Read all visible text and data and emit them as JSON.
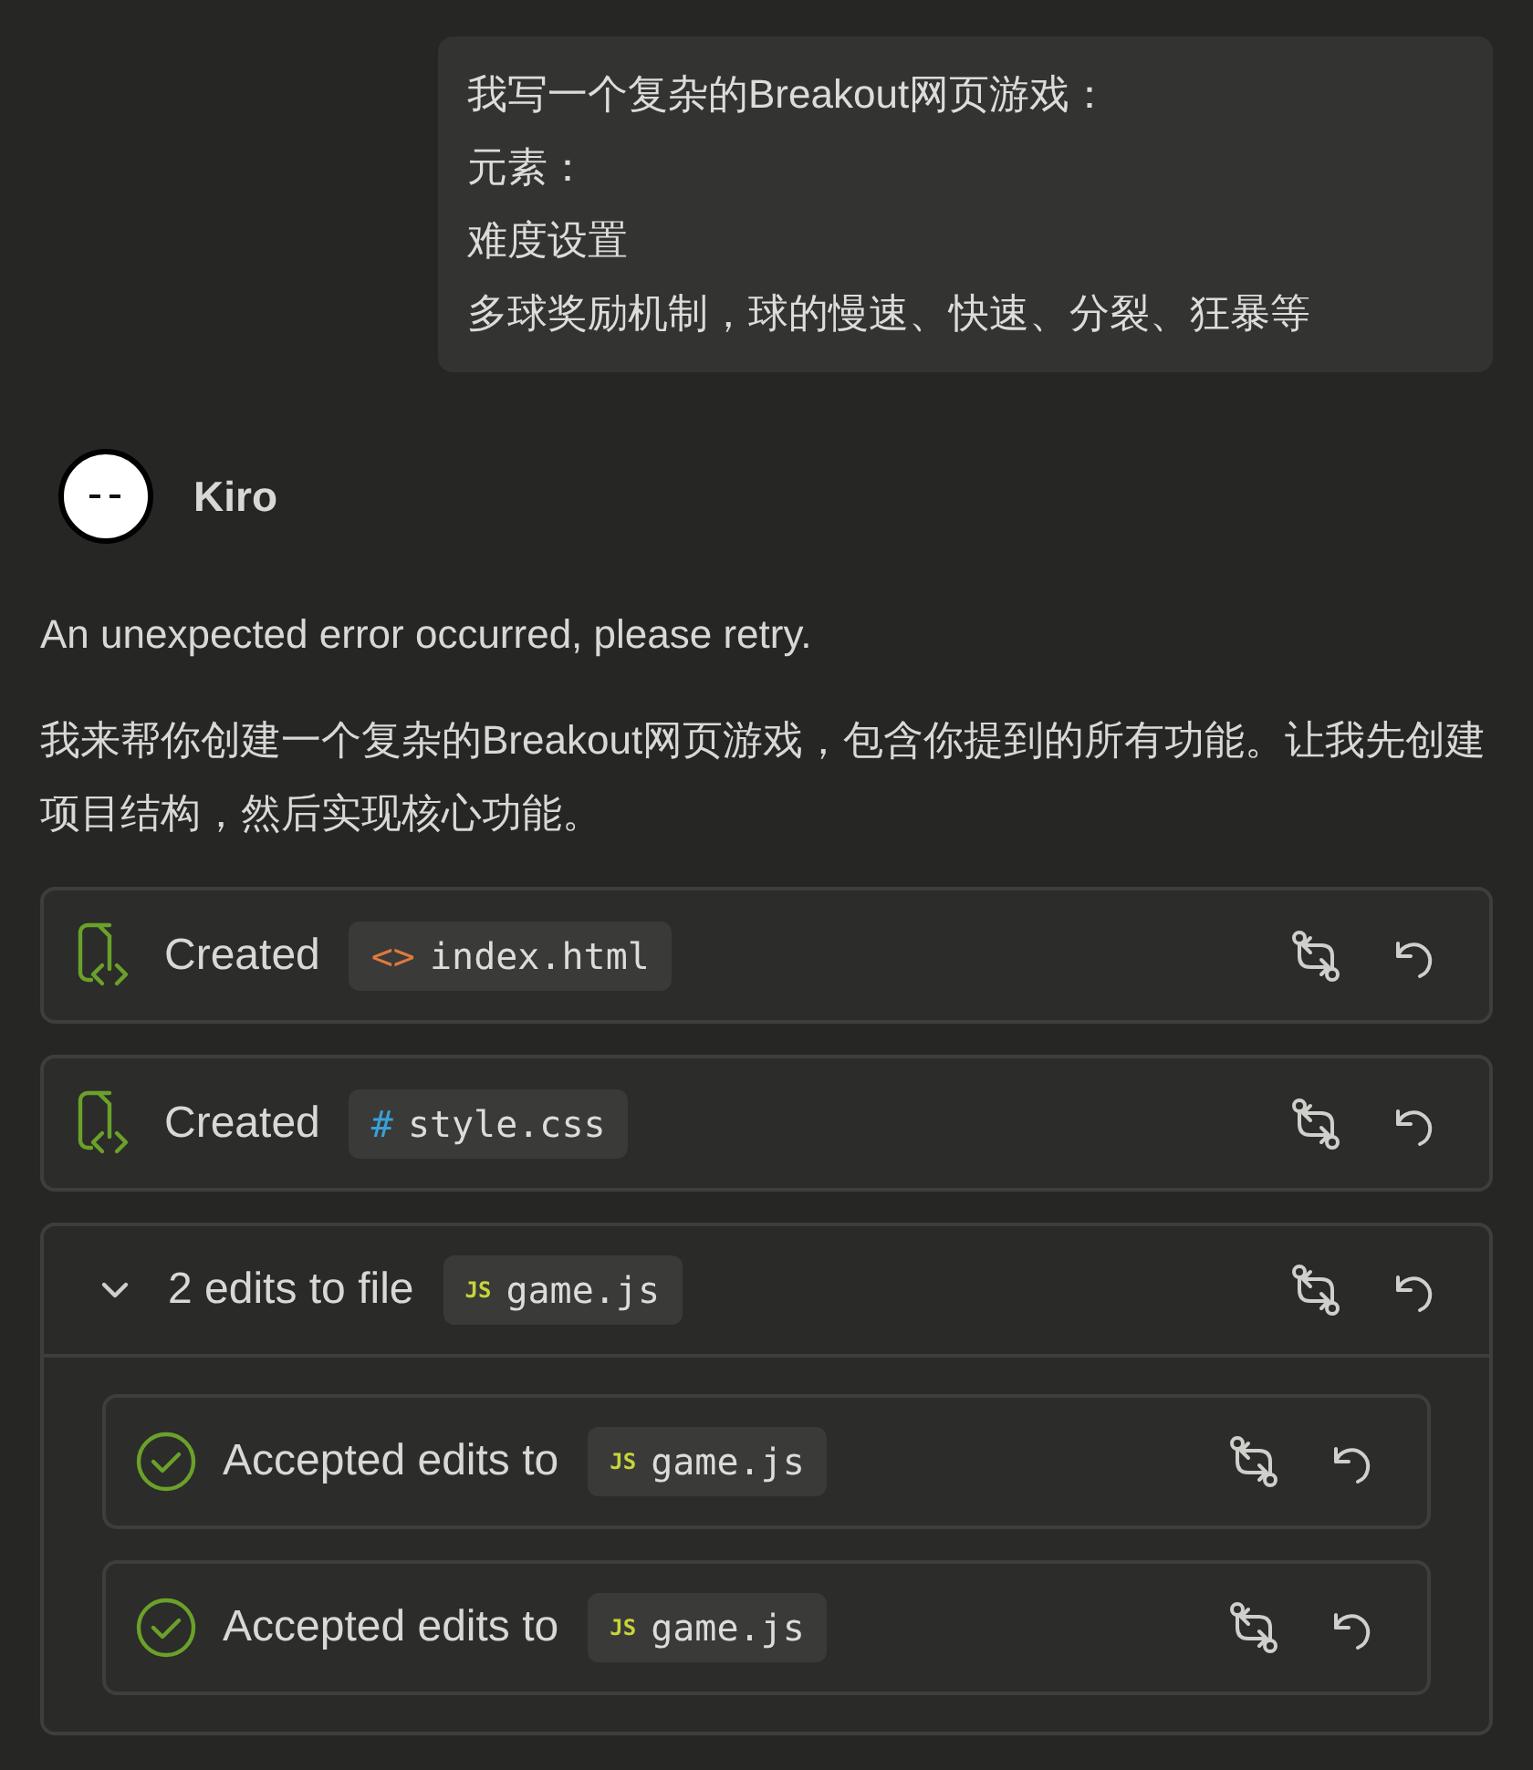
{
  "user_message": {
    "lines": [
      "我写一个复杂的Breakout网页游戏：",
      "元素：",
      "难度设置",
      "多球奖励机制，球的慢速、快速、分裂、狂暴等"
    ]
  },
  "agent": {
    "name": "Kiro"
  },
  "messages": [
    "An unexpected error occurred, please retry.",
    "我来帮你创建一个复杂的Breakout网页游戏，包含你提到的所有功能。让我先创建项目结构，然后实现核心功能。"
  ],
  "actions": [
    {
      "kind": "created",
      "label": "Created",
      "file": {
        "kind": "html",
        "badge": "<>",
        "name": "index.html"
      }
    },
    {
      "kind": "created",
      "label": "Created",
      "file": {
        "kind": "css",
        "badge": "#",
        "name": "style.css"
      }
    },
    {
      "kind": "group",
      "label": "2 edits to file",
      "expanded": true,
      "file": {
        "kind": "js",
        "badge": "JS",
        "name": "game.js"
      },
      "children": [
        {
          "kind": "accepted",
          "label": "Accepted edits to",
          "file": {
            "kind": "js",
            "badge": "JS",
            "name": "game.js"
          }
        },
        {
          "kind": "accepted",
          "label": "Accepted edits to",
          "file": {
            "kind": "js",
            "badge": "JS",
            "name": "game.js"
          }
        }
      ]
    }
  ]
}
